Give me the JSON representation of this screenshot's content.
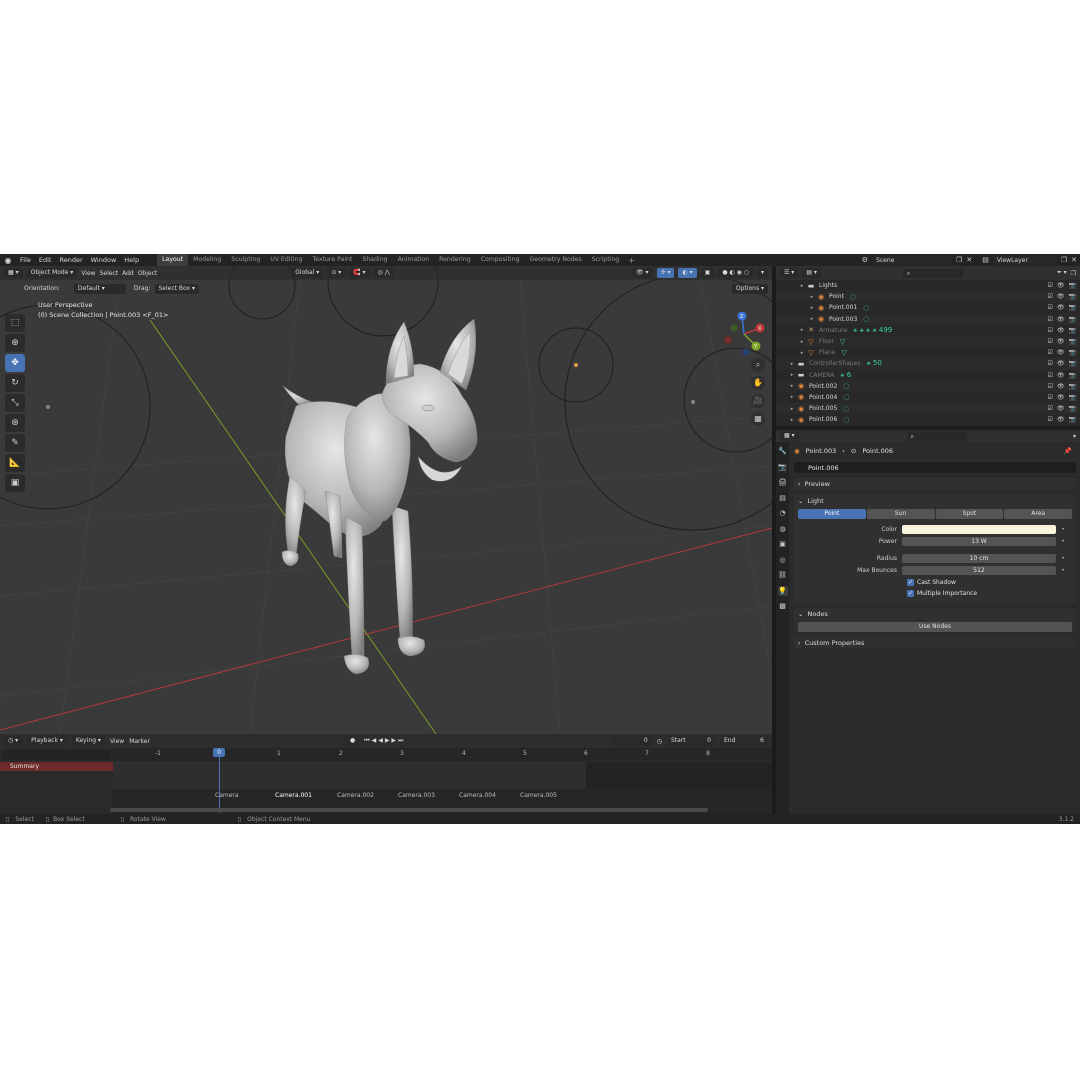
{
  "topbar": {
    "menus": [
      "File",
      "Edit",
      "Render",
      "Window",
      "Help"
    ],
    "workspaces": [
      "Layout",
      "Modeling",
      "Sculpting",
      "UV Editing",
      "Texture Paint",
      "Shading",
      "Animation",
      "Rendering",
      "Compositing",
      "Geometry Nodes",
      "Scripting"
    ],
    "active_workspace": "Layout",
    "scene": "Scene",
    "view_layer": "ViewLayer"
  },
  "viewport": {
    "mode": "Object Mode",
    "menus": [
      "View",
      "Select",
      "Add",
      "Object"
    ],
    "transform_orientation": "Global",
    "orientation_label": "Orientation:",
    "orientation_value": "Default",
    "drag_label": "Drag:",
    "drag_value": "Select Box",
    "options_label": "Options",
    "info_line1": "User Perspective",
    "info_line2": "(0) Scene Collection | Point.003 <F_01>",
    "tools": [
      "select-box-icon",
      "cursor-icon",
      "move-icon",
      "rotate-icon",
      "scale-icon",
      "transform-icon",
      "annotate-icon",
      "measure-icon",
      "add-cube-icon"
    ],
    "active_tool": "move-icon",
    "gizmo_axes": [
      "X",
      "Y",
      "Z"
    ]
  },
  "timeline": {
    "menus": [
      "Playback",
      "Keying",
      "View",
      "Marker"
    ],
    "current_frame": "0",
    "start_label": "Start",
    "start_value": "0",
    "end_label": "End",
    "end_value": "6",
    "summary": "Summary",
    "frames": [
      "-1",
      "0",
      "1",
      "2",
      "3",
      "4",
      "5",
      "6",
      "7",
      "8"
    ],
    "markers": [
      "Camera",
      "Camera.001",
      "Camera.002",
      "Camera.003",
      "Camera.004",
      "Camera.005"
    ],
    "selected_marker": "Camera.001"
  },
  "statusbar": {
    "items": [
      "Select",
      "Box Select",
      "Rotate View",
      "Object Context Menu"
    ],
    "version": "3.1.2"
  },
  "outliner": {
    "rows": [
      {
        "name": "Lights",
        "indent": 1,
        "icon": "collection-icon",
        "dim": false,
        "extra": ""
      },
      {
        "name": "Point",
        "indent": 2,
        "icon": "light-icon",
        "dim": false,
        "extra": "◌"
      },
      {
        "name": "Point.001",
        "indent": 2,
        "icon": "light-icon",
        "dim": false,
        "extra": "◌"
      },
      {
        "name": "Point.003",
        "indent": 2,
        "icon": "light-icon",
        "dim": false,
        "extra": "◌"
      },
      {
        "name": "Armature",
        "indent": 1,
        "icon": "armature-icon",
        "dim": true,
        "extra": "⚹ ⚹ ⚹ ⚹ 499"
      },
      {
        "name": "Floor",
        "indent": 1,
        "icon": "mesh-icon",
        "dim": true,
        "extra": "▽"
      },
      {
        "name": "Plane",
        "indent": 1,
        "icon": "mesh-icon",
        "dim": true,
        "extra": "▽"
      },
      {
        "name": "ControllerShapes",
        "indent": 0,
        "icon": "collection-icon",
        "dim": true,
        "extra": "⚹ 50"
      },
      {
        "name": "CAMERA",
        "indent": 0,
        "icon": "collection-icon",
        "dim": true,
        "extra": "⚹ 6"
      },
      {
        "name": "Point.002",
        "indent": 0,
        "icon": "light-icon",
        "dim": false,
        "extra": "◌"
      },
      {
        "name": "Point.004",
        "indent": 0,
        "icon": "light-icon",
        "dim": false,
        "extra": "◌"
      },
      {
        "name": "Point.005",
        "indent": 0,
        "icon": "light-icon",
        "dim": false,
        "extra": "◌"
      },
      {
        "name": "Point.006",
        "indent": 0,
        "icon": "light-icon",
        "dim": false,
        "extra": "◌"
      }
    ]
  },
  "properties": {
    "breadcrumb_object": "Point.003",
    "breadcrumb_data": "Point.006",
    "datablock_name": "Point.006",
    "preview_label": "Preview",
    "light_label": "Light",
    "light_types": [
      "Point",
      "Sun",
      "Spot",
      "Area"
    ],
    "active_light_type": "Point",
    "color_label": "Color",
    "color_value": "#f7f3dd",
    "power_label": "Power",
    "power_value": "13 W",
    "radius_label": "Radius",
    "radius_value": "10 cm",
    "bounces_label": "Max Bounces",
    "bounces_value": "512",
    "cast_shadow_label": "Cast Shadow",
    "multiple_importance_label": "Multiple Importance",
    "nodes_label": "Nodes",
    "use_nodes_label": "Use Nodes",
    "custom_props_label": "Custom Properties"
  },
  "colors": {
    "accent": "#4772b3",
    "viewport_bg": "#3a3a3a",
    "x_axis": "#c0383d",
    "y_axis": "#7fa626",
    "z_axis": "#3c75d6",
    "light_icon": "#e08a3c",
    "green_icon": "#3ad5a5"
  }
}
